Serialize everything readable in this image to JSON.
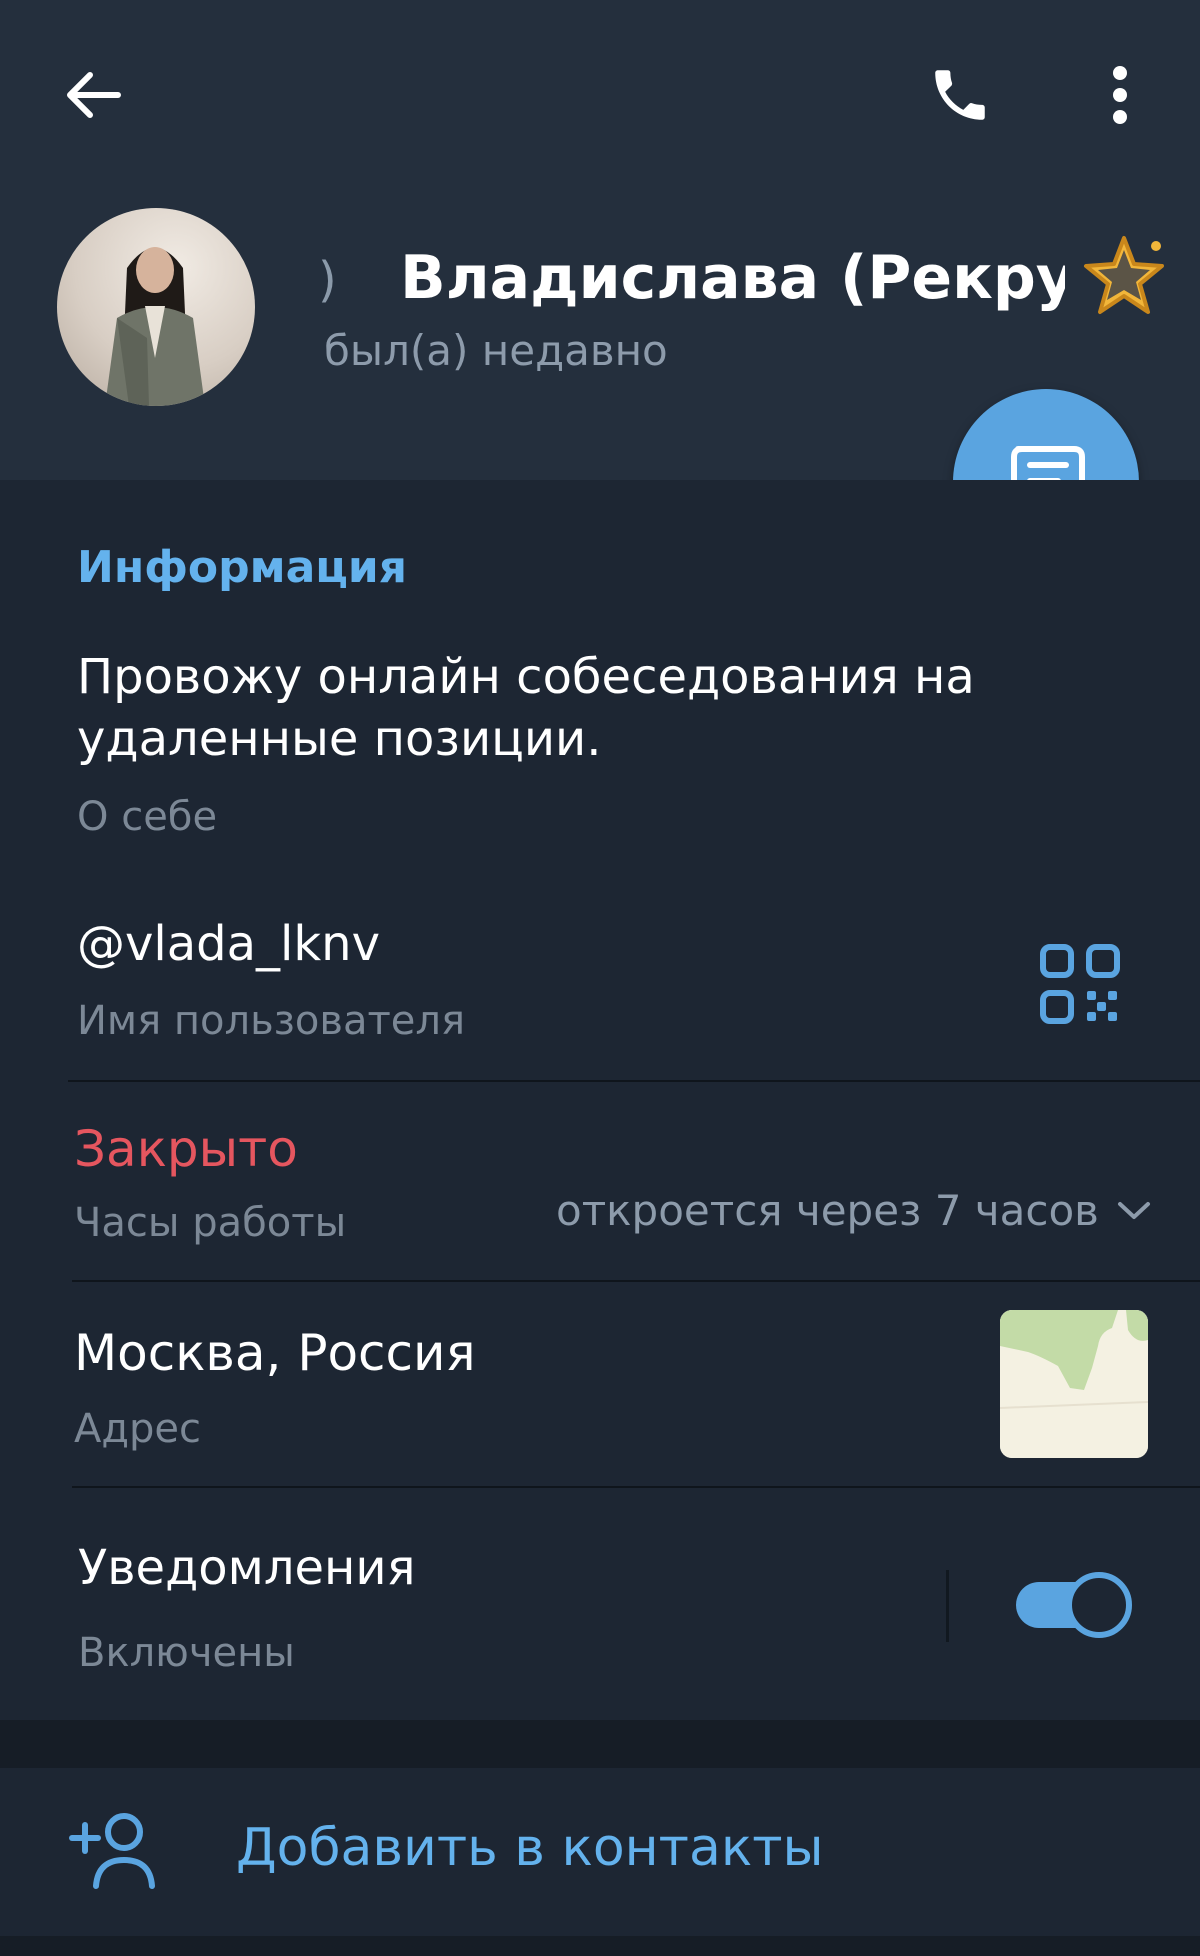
{
  "header": {
    "name_fragment": ")",
    "name": "Владислава (Рекрутер",
    "status": "был(а) недавно"
  },
  "info": {
    "section_title": "Информация",
    "bio": "Провожу онлайн собеседования на удаленные позиции.",
    "bio_caption": "О себе",
    "username": "@vlada_lknv",
    "username_caption": "Имя пользователя",
    "hours_status": "Закрыто",
    "hours_caption": "Часы работы",
    "hours_value": "откроется через 7 часов",
    "address": "Москва, Россия",
    "address_caption": "Адрес",
    "notifications": "Уведомления",
    "notifications_state": "Включены"
  },
  "actions": {
    "add_contact": "Добавить в контакты"
  },
  "icons": {
    "back": "arrow-left-icon",
    "call": "phone-icon",
    "more": "more-vertical-icon",
    "message": "message-icon",
    "qr": "qr-code-icon",
    "chevron": "chevron-down-icon",
    "add_contact": "add-user-icon",
    "premium": "star-icon"
  },
  "colors": {
    "header_bg": "#242f3d",
    "card_bg": "#1d2633",
    "accent": "#5aa4e0",
    "link": "#64b2ed",
    "closed": "#e5565f"
  },
  "notifications_enabled": true
}
